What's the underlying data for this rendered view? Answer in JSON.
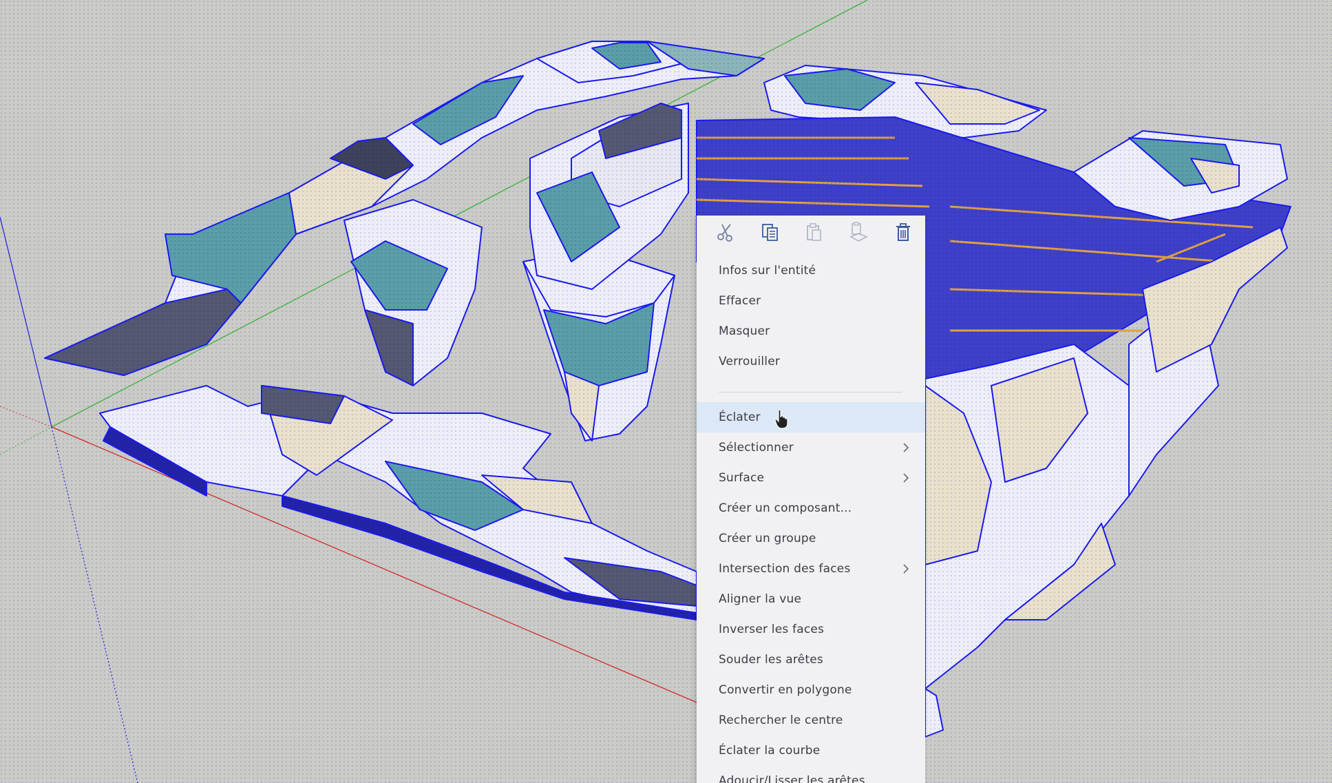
{
  "app": {
    "background_color": "#cbcbc7",
    "model_edge_color": "#1a1af0"
  },
  "context_menu": {
    "toolbar": [
      {
        "icon": "scissors-icon",
        "action": "cut"
      },
      {
        "icon": "copy-icon",
        "action": "copy"
      },
      {
        "icon": "paste-icon",
        "action": "paste"
      },
      {
        "icon": "paste-in-place-icon",
        "action": "paste-in-place"
      },
      {
        "icon": "trash-icon",
        "action": "delete"
      }
    ],
    "items_top": [
      {
        "label": "Infos sur l'entité"
      },
      {
        "label": "Effacer"
      },
      {
        "label": "Masquer"
      },
      {
        "label": "Verrouiller"
      }
    ],
    "items_bottom": [
      {
        "label": "Éclater",
        "highlighted": true
      },
      {
        "label": "Sélectionner",
        "submenu": true
      },
      {
        "label": "Surface",
        "submenu": true
      },
      {
        "label": "Créer un composant..."
      },
      {
        "label": "Créer un groupe"
      },
      {
        "label": "Intersection des faces",
        "submenu": true
      },
      {
        "label": "Aligner la vue"
      },
      {
        "label": "Inverser les faces"
      },
      {
        "label": "Souder les arêtes"
      },
      {
        "label": "Convertir en polygone"
      },
      {
        "label": "Rechercher le centre"
      },
      {
        "label": "Éclater la courbe"
      },
      {
        "label": "Adoucir/Lisser les arêtes"
      }
    ],
    "highlight_color": "#dce8f6"
  }
}
